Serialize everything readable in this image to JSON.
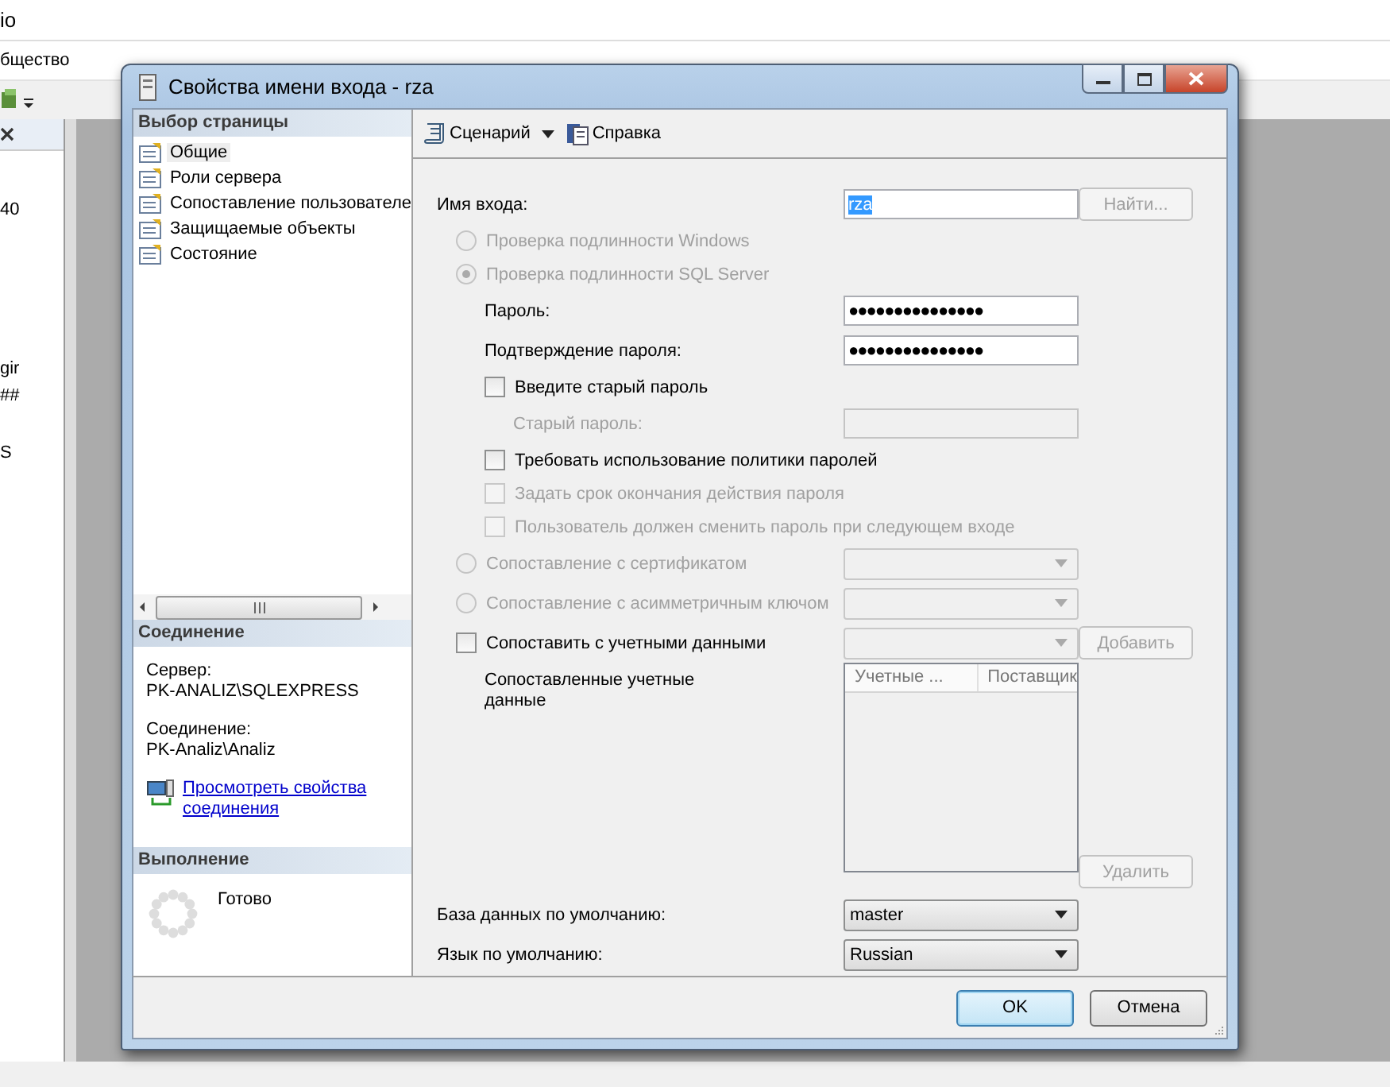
{
  "app": {
    "title": "io",
    "menu": [
      "бщество"
    ],
    "fragments": [
      "40",
      "gir",
      "##",
      "S"
    ]
  },
  "dialog": {
    "title": "Свойства имени входа - rza",
    "pages_header": "Выбор страницы",
    "pages": [
      {
        "label": "Общие",
        "selected": true
      },
      {
        "label": "Роли сервера",
        "selected": false
      },
      {
        "label": "Сопоставление пользователе",
        "selected": false
      },
      {
        "label": "Защищаемые объекты",
        "selected": false
      },
      {
        "label": "Состояние",
        "selected": false
      }
    ],
    "connection_header": "Соединение",
    "connection": [
      {
        "label": "Сервер:",
        "value": "PK-ANALIZ\\SQLEXPRESS"
      },
      {
        "label": "Соединение:",
        "value": "PK-Analiz\\Analiz"
      }
    ],
    "connection_link": "Просмотреть свойства соединения",
    "progress_header": "Выполнение",
    "progress_status": "Готово",
    "toolbar": [
      {
        "kind": "script",
        "label": "Сценарий",
        "dropdown": true
      },
      {
        "kind": "help",
        "label": "Справка",
        "dropdown": false
      }
    ],
    "form": [
      {
        "kind": "text",
        "label": "Имя входа:",
        "value": "rza",
        "value_selected": true,
        "disabled": false,
        "button": {
          "label": "Найти...",
          "disabled": true
        }
      },
      {
        "kind": "radio",
        "label": "Проверка подлинности Windows",
        "selected": false,
        "disabled": true
      },
      {
        "kind": "radio",
        "label": "Проверка подлинности SQL Server",
        "selected": true,
        "disabled": true,
        "children": [
          {
            "kind": "text",
            "label": "Пароль:",
            "value": "●●●●●●●●●●●●●●●",
            "disabled": false
          },
          {
            "kind": "text",
            "label": "Подтверждение пароля:",
            "value": "●●●●●●●●●●●●●●●",
            "disabled": false
          },
          {
            "kind": "checkbox",
            "label": "Введите старый пароль",
            "checked": false,
            "disabled": false,
            "children": [
              {
                "kind": "text",
                "label": "Старый пароль:",
                "disabled": true
              }
            ]
          },
          {
            "kind": "checkbox",
            "label": "Требовать использование политики паролей",
            "checked": false,
            "disabled": false
          },
          {
            "kind": "checkbox",
            "label": "Задать срок окончания действия пароля",
            "checked": false,
            "disabled": true
          },
          {
            "kind": "checkbox",
            "label": "Пользователь должен сменить пароль при следующем входе",
            "checked": false,
            "disabled": true
          }
        ]
      },
      {
        "kind": "radio",
        "label": "Сопоставление с сертификатом",
        "selected": false,
        "disabled": true,
        "combo": {
          "disabled": true
        }
      },
      {
        "kind": "radio",
        "label": "Сопоставление с асимметричным ключом",
        "selected": false,
        "disabled": true,
        "combo": {
          "disabled": true
        }
      },
      {
        "kind": "checkbox",
        "label": "Сопоставить с учетными данными",
        "checked": false,
        "disabled": false,
        "combo": {
          "disabled": true
        },
        "button": {
          "label": "Добавить",
          "disabled": true
        },
        "children": [
          {
            "kind": "list",
            "label": "Сопоставленные учетные данные",
            "columns": [
              "Учетные ...",
              "Поставщик"
            ],
            "button": {
              "label": "Удалить",
              "disabled": true
            }
          }
        ]
      },
      {
        "kind": "combo",
        "label": "База данных по умолчанию:",
        "combo": {
          "value": "master",
          "disabled": false
        }
      },
      {
        "kind": "combo",
        "label": "Язык по умолчанию:",
        "combo": {
          "value": "Russian",
          "disabled": false
        }
      }
    ],
    "buttons": [
      {
        "label": "OK",
        "default": true
      },
      {
        "label": "Отмена",
        "default": false
      }
    ]
  }
}
